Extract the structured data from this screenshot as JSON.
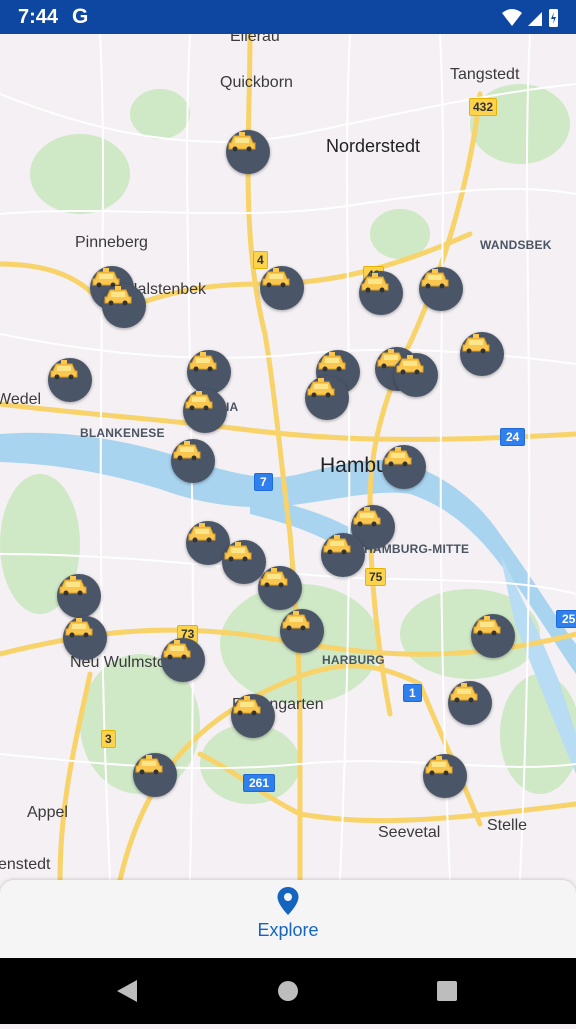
{
  "status_bar": {
    "time": "7:44",
    "google_icon": "G",
    "icons": [
      "wifi-icon",
      "battery-charging-icon"
    ]
  },
  "map": {
    "places": {
      "quickborn": "Quickborn",
      "tangstedt": "Tangstedt",
      "norderstedt": "Norderstedt",
      "pinneberg": "Pinneberg",
      "halstenbek": "Halstenbek",
      "wandsbek": "WANDSBEK",
      "wedel": "Wedel",
      "blankenese": "BLANKENESE",
      "hamburg": "Hamburg",
      "hamburg_mitte": "HAMBURG-MITTE",
      "neu_wulmstorf": "Neu Wulmstorf",
      "harburg": "HARBURG",
      "rosengarten": "Rosengarten",
      "appel": "Appel",
      "seevetal": "Seevetal",
      "stelle": "Stelle",
      "ellerau": "Ellerau",
      "gnestedt": "enstedt",
      "othmarschen": "IA"
    },
    "road_shields": {
      "r432": "432",
      "r4": "4",
      "r43": "43",
      "r24": "24",
      "r7": "7",
      "r75": "75",
      "r73": "73",
      "r25": "25",
      "r1": "1",
      "r3": "3",
      "r261": "261"
    },
    "taxi_icon": "taxi-icon",
    "taxi_count": 31
  },
  "bottom_nav": {
    "explore_icon": "location-pin-icon",
    "explore_label": "Explore"
  },
  "android_nav": {
    "back": "back-icon",
    "home": "home-icon",
    "recents": "recents-icon"
  }
}
